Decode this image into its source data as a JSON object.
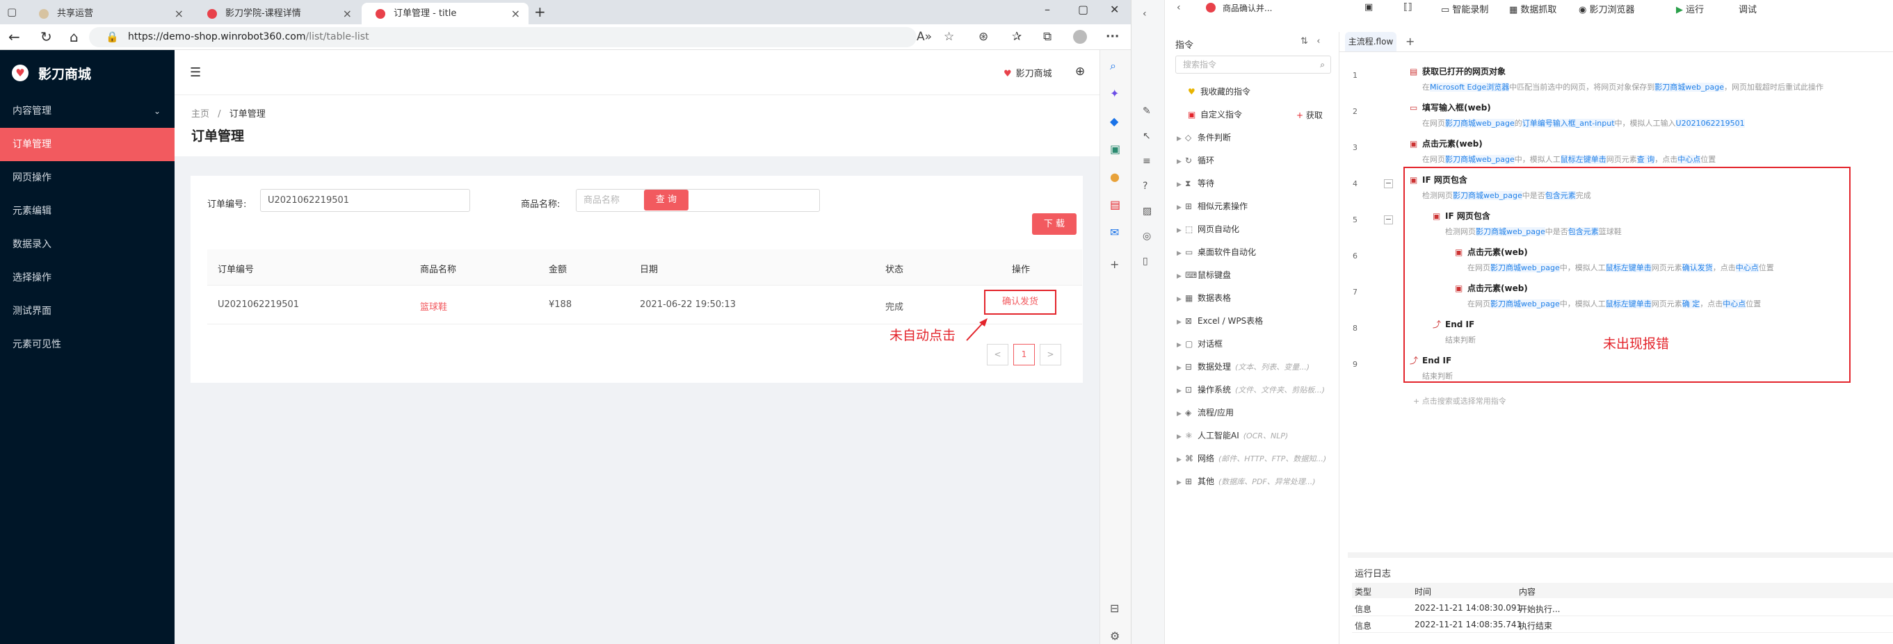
{
  "browser": {
    "tabs": [
      {
        "label": "共享运营"
      },
      {
        "label": "影刀学院-课程详情"
      },
      {
        "label": "订单管理 - title"
      }
    ],
    "url": "https://demo-shop.winrobot360.com/list/table-list",
    "url_host": "https://demo-shop.winrobot360.com",
    "url_path": "/list/table-list"
  },
  "app": {
    "logo_text": "影刀商城",
    "shop_link": "影刀商城",
    "menu": [
      {
        "label": "内容管理",
        "has_arrow": true
      },
      {
        "label": "订单管理",
        "active": true
      },
      {
        "label": "网页操作"
      },
      {
        "label": "元素编辑"
      },
      {
        "label": "数据录入"
      },
      {
        "label": "选择操作"
      },
      {
        "label": "测试界面"
      },
      {
        "label": "元素可见性"
      }
    ],
    "breadcrumb": {
      "home": "主页",
      "sep": "/",
      "current": "订单管理"
    },
    "page_title": "订单管理",
    "filter": {
      "order_label": "订单编号:",
      "order_value": "U2021062219501",
      "product_label": "商品名称:",
      "product_placeholder": "商品名称",
      "search_label": "查 询",
      "download_label": "下 载"
    },
    "table": {
      "headers": [
        "订单编号",
        "商品名称",
        "金额",
        "日期",
        "状态",
        "操作"
      ],
      "rows": [
        {
          "order": "U2021062219501",
          "product": "篮球鞋",
          "amount": "¥188",
          "date": "2021-06-22 19:50:13",
          "status": "完成",
          "action": "确认发货"
        }
      ]
    },
    "pager": {
      "prev": "<",
      "page": "1",
      "next": ">"
    },
    "annotation": "未自动点击"
  },
  "rpa": {
    "project_name": "商品确认并...",
    "toolbar": {
      "record": "智能录制",
      "capture": "数据抓取",
      "browser": "影刀浏览器",
      "run": "运行",
      "debug": "调试"
    },
    "commands": {
      "header": "指令",
      "search_placeholder": "搜索指令",
      "fetch": "获取",
      "items": [
        {
          "label": "我收藏的指令",
          "arrow": false
        },
        {
          "label": "自定义指令",
          "arrow": false
        },
        {
          "label": "条件判断",
          "arrow": true
        },
        {
          "label": "循环",
          "arrow": true
        },
        {
          "label": "等待",
          "arrow": true
        },
        {
          "label": "相似元素操作",
          "arrow": true
        },
        {
          "label": "网页自动化",
          "arrow": true
        },
        {
          "label": "桌面软件自动化",
          "arrow": true
        },
        {
          "label": "鼠标键盘",
          "arrow": true
        },
        {
          "label": "数据表格",
          "arrow": true
        },
        {
          "label": "Excel / WPS表格",
          "arrow": true
        },
        {
          "label": "对话框",
          "arrow": true
        },
        {
          "label": "数据处理",
          "arrow": true,
          "hint": "(文本、列表、变量...)"
        },
        {
          "label": "操作系统",
          "arrow": true,
          "hint": "(文件、文件夹、剪贴板...)"
        },
        {
          "label": "流程/应用",
          "arrow": true
        },
        {
          "label": "人工智能AI",
          "arrow": true,
          "hint": "(OCR、NLP)"
        },
        {
          "label": "网络",
          "arrow": true,
          "hint": "(邮件、HTTP、FTP、数据知...)"
        },
        {
          "label": "其他",
          "arrow": true,
          "hint": "(数据库、PDF、异常处理...)"
        }
      ]
    },
    "flow": {
      "tab": "主流程.flow",
      "steps": [
        {
          "n": "1",
          "title": "获取已打开的网页对象",
          "desc": [
            "在",
            "Microsoft Edge浏览器",
            "中匹配当前选中的网页，将网页对象保存到",
            "影刀商城web_page",
            "，网页加载超时后重试此操作"
          ]
        },
        {
          "n": "2",
          "title": "填写输入框(web)",
          "desc": [
            "在网页",
            "影刀商城web_page",
            "的",
            "订单编号输入框_ant-input",
            "中，模拟人工输入",
            "U2021062219501"
          ]
        },
        {
          "n": "3",
          "title": "点击元素(web)",
          "desc": [
            "在网页",
            "影刀商城web_page",
            "中，模拟人工",
            "鼠标左键单击",
            "网页元素",
            "查 询",
            "，点击",
            "中心点",
            "位置"
          ]
        },
        {
          "n": "4",
          "title": "IF 网页包含",
          "desc": [
            "检测网页",
            "影刀商城web_page",
            "中是否",
            "包含元素",
            "完成"
          ]
        },
        {
          "n": "5",
          "title": "IF 网页包含",
          "desc": [
            "检测网页",
            "影刀商城web_page",
            "中是否",
            "包含元素",
            "篮球鞋"
          ]
        },
        {
          "n": "6",
          "title": "点击元素(web)",
          "desc": [
            "在网页",
            "影刀商城web_page",
            "中，模拟人工",
            "鼠标左键单击",
            "网页元素",
            "确认发货",
            "，点击",
            "中心点",
            "位置"
          ]
        },
        {
          "n": "7",
          "title": "点击元素(web)",
          "desc": [
            "在网页",
            "影刀商城web_page",
            "中，模拟人工",
            "鼠标左键单击",
            "网页元素",
            "确 定",
            "，点击",
            "中心点",
            "位置"
          ]
        },
        {
          "n": "8",
          "title": "End IF",
          "desc": [
            "结束判断"
          ]
        },
        {
          "n": "9",
          "title": "End IF",
          "desc": [
            "结束判断"
          ]
        }
      ],
      "add_hint": "+ 点击搜索或选择常用指令",
      "annotation": "未出现报错"
    },
    "log": {
      "title": "运行日志",
      "headers": [
        "类型",
        "时间",
        "内容"
      ],
      "rows": [
        {
          "type": "信息",
          "time": "2022-11-21 14:08:30.091",
          "content": "开始执行..."
        },
        {
          "type": "信息",
          "time": "2022-11-21 14:08:35.741",
          "content": "执行结束"
        }
      ]
    }
  }
}
